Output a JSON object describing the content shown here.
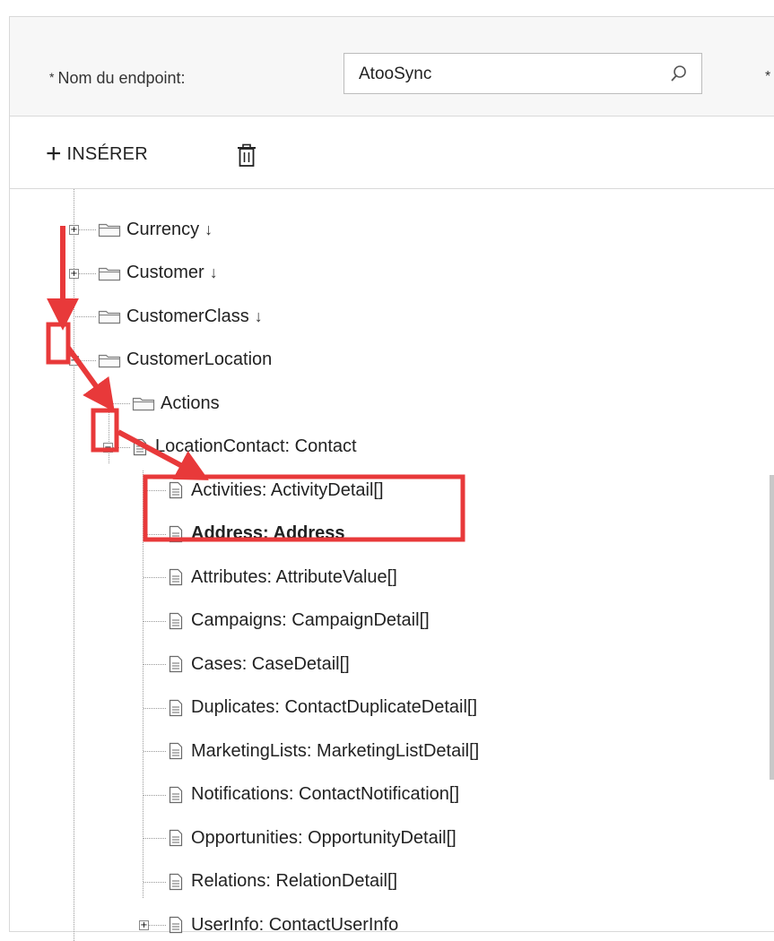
{
  "endpoint": {
    "required_marker": "*",
    "label": "Nom du endpoint:",
    "value": "AtooSync",
    "icon": "search-icon",
    "next_required_marker": "*"
  },
  "toolbar": {
    "insert_label": "INSÉRER",
    "insert_icon": "plus-icon",
    "delete_icon": "trash-icon"
  },
  "tree": {
    "nodes": [
      {
        "label": "Currency",
        "suffix": "↓",
        "icon": "folder-icon",
        "toggle": "+"
      },
      {
        "label": "Customer",
        "suffix": "↓",
        "icon": "folder-icon",
        "toggle": "+"
      },
      {
        "label": "CustomerClass",
        "suffix": "↓",
        "icon": "folder-icon",
        "toggle": ""
      },
      {
        "label": "CustomerLocation",
        "suffix": "",
        "icon": "folder-icon",
        "toggle": "−"
      },
      {
        "label": "Actions",
        "suffix": "",
        "icon": "folder-icon",
        "toggle": ""
      },
      {
        "label": "LocationContact: Contact",
        "suffix": "",
        "icon": "document-icon",
        "toggle": "−"
      },
      {
        "label": "Activities: ActivityDetail[]",
        "suffix": "",
        "icon": "document-icon",
        "toggle": ""
      },
      {
        "label": "Address: Address",
        "suffix": "",
        "icon": "document-icon",
        "toggle": "",
        "selected": true
      },
      {
        "label": "Attributes: AttributeValue[]",
        "suffix": "",
        "icon": "document-icon",
        "toggle": ""
      },
      {
        "label": "Campaigns: CampaignDetail[]",
        "suffix": "",
        "icon": "document-icon",
        "toggle": ""
      },
      {
        "label": "Cases: CaseDetail[]",
        "suffix": "",
        "icon": "document-icon",
        "toggle": ""
      },
      {
        "label": "Duplicates: ContactDuplicateDetail[]",
        "suffix": "",
        "icon": "document-icon",
        "toggle": ""
      },
      {
        "label": "MarketingLists: MarketingListDetail[]",
        "suffix": "",
        "icon": "document-icon",
        "toggle": ""
      },
      {
        "label": "Notifications: ContactNotification[]",
        "suffix": "",
        "icon": "document-icon",
        "toggle": ""
      },
      {
        "label": "Opportunities: OpportunityDetail[]",
        "suffix": "",
        "icon": "document-icon",
        "toggle": ""
      },
      {
        "label": "Relations: RelationDetail[]",
        "suffix": "",
        "icon": "document-icon",
        "toggle": ""
      },
      {
        "label": "UserInfo: ContactUserInfo",
        "suffix": "",
        "icon": "document-icon",
        "toggle": "+"
      }
    ]
  },
  "annotation_color": "#e8393a"
}
